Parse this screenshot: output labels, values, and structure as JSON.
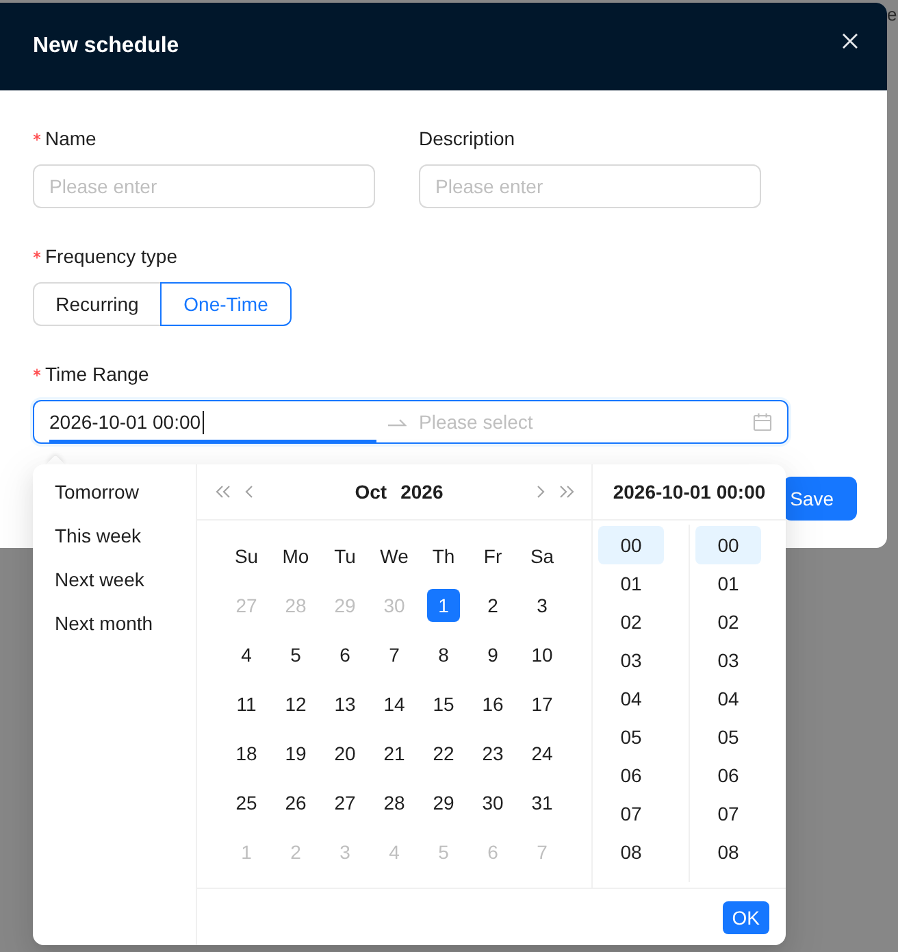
{
  "background": {
    "text": "e"
  },
  "dialog": {
    "title": "New schedule",
    "fields": [
      {
        "label": "Name",
        "required": true,
        "placeholder": "Please enter"
      },
      {
        "label": "Description",
        "required": false,
        "placeholder": "Please enter"
      }
    ],
    "frequency_type": {
      "label": "Frequency type",
      "required": true,
      "options": [
        {
          "label": "Recurring",
          "selected": false
        },
        {
          "label": "One-Time",
          "selected": true
        }
      ]
    },
    "time_range": {
      "label": "Time Range",
      "required": true,
      "start": {
        "value": "2026-10-01 00:00",
        "active": true
      },
      "end": {
        "placeholder": "Please select",
        "active": false
      }
    },
    "buttons": [
      "Save"
    ]
  },
  "picker": {
    "presets": [
      "Tomorrow",
      "This week",
      "Next week",
      "Next month"
    ],
    "calendar": {
      "month": "Oct",
      "year": "2026",
      "weekdays": [
        "Su",
        "Mo",
        "Tu",
        "We",
        "Th",
        "Fr",
        "Sa"
      ],
      "weeks": [
        [
          {
            "day": "27",
            "in_month": false,
            "selected": false
          },
          {
            "day": "28",
            "in_month": false,
            "selected": false
          },
          {
            "day": "29",
            "in_month": false,
            "selected": false
          },
          {
            "day": "30",
            "in_month": false,
            "selected": false
          },
          {
            "day": "1",
            "in_month": true,
            "selected": true
          },
          {
            "day": "2",
            "in_month": true,
            "selected": false
          },
          {
            "day": "3",
            "in_month": true,
            "selected": false
          }
        ],
        [
          {
            "day": "4",
            "in_month": true,
            "selected": false
          },
          {
            "day": "5",
            "in_month": true,
            "selected": false
          },
          {
            "day": "6",
            "in_month": true,
            "selected": false
          },
          {
            "day": "7",
            "in_month": true,
            "selected": false
          },
          {
            "day": "8",
            "in_month": true,
            "selected": false
          },
          {
            "day": "9",
            "in_month": true,
            "selected": false
          },
          {
            "day": "10",
            "in_month": true,
            "selected": false
          }
        ],
        [
          {
            "day": "11",
            "in_month": true,
            "selected": false
          },
          {
            "day": "12",
            "in_month": true,
            "selected": false
          },
          {
            "day": "13",
            "in_month": true,
            "selected": false
          },
          {
            "day": "14",
            "in_month": true,
            "selected": false
          },
          {
            "day": "15",
            "in_month": true,
            "selected": false
          },
          {
            "day": "16",
            "in_month": true,
            "selected": false
          },
          {
            "day": "17",
            "in_month": true,
            "selected": false
          }
        ],
        [
          {
            "day": "18",
            "in_month": true,
            "selected": false
          },
          {
            "day": "19",
            "in_month": true,
            "selected": false
          },
          {
            "day": "20",
            "in_month": true,
            "selected": false
          },
          {
            "day": "21",
            "in_month": true,
            "selected": false
          },
          {
            "day": "22",
            "in_month": true,
            "selected": false
          },
          {
            "day": "23",
            "in_month": true,
            "selected": false
          },
          {
            "day": "24",
            "in_month": true,
            "selected": false
          }
        ],
        [
          {
            "day": "25",
            "in_month": true,
            "selected": false
          },
          {
            "day": "26",
            "in_month": true,
            "selected": false
          },
          {
            "day": "27",
            "in_month": true,
            "selected": false
          },
          {
            "day": "28",
            "in_month": true,
            "selected": false
          },
          {
            "day": "29",
            "in_month": true,
            "selected": false
          },
          {
            "day": "30",
            "in_month": true,
            "selected": false
          },
          {
            "day": "31",
            "in_month": true,
            "selected": false
          }
        ],
        [
          {
            "day": "1",
            "in_month": false,
            "selected": false
          },
          {
            "day": "2",
            "in_month": false,
            "selected": false
          },
          {
            "day": "3",
            "in_month": false,
            "selected": false
          },
          {
            "day": "4",
            "in_month": false,
            "selected": false
          },
          {
            "day": "5",
            "in_month": false,
            "selected": false
          },
          {
            "day": "6",
            "in_month": false,
            "selected": false
          },
          {
            "day": "7",
            "in_month": false,
            "selected": false
          }
        ]
      ]
    },
    "time": {
      "title": "2026-10-01 00:00",
      "hours": [
        {
          "label": "00",
          "selected": true
        },
        {
          "label": "01",
          "selected": false
        },
        {
          "label": "02",
          "selected": false
        },
        {
          "label": "03",
          "selected": false
        },
        {
          "label": "04",
          "selected": false
        },
        {
          "label": "05",
          "selected": false
        },
        {
          "label": "06",
          "selected": false
        },
        {
          "label": "07",
          "selected": false
        },
        {
          "label": "08",
          "selected": false
        }
      ],
      "minutes": [
        {
          "label": "00",
          "selected": true
        },
        {
          "label": "01",
          "selected": false
        },
        {
          "label": "02",
          "selected": false
        },
        {
          "label": "03",
          "selected": false
        },
        {
          "label": "04",
          "selected": false
        },
        {
          "label": "05",
          "selected": false
        },
        {
          "label": "06",
          "selected": false
        },
        {
          "label": "07",
          "selected": false
        },
        {
          "label": "08",
          "selected": false
        }
      ]
    },
    "ok_button": "OK"
  }
}
